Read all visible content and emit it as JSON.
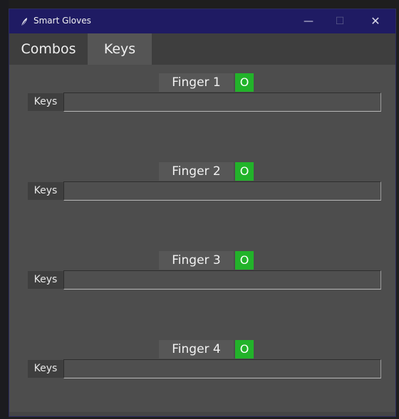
{
  "window": {
    "title": "Smart Gloves",
    "minimize_glyph": "—",
    "maximize_glyph": "☐",
    "close_glyph": "✕"
  },
  "tabs": [
    {
      "label": "Combos",
      "selected": false
    },
    {
      "label": "Keys",
      "selected": true
    }
  ],
  "fingers": [
    {
      "label": "Finger 1",
      "status": "O",
      "keys_label": "Keys",
      "keys_value": ""
    },
    {
      "label": "Finger 2",
      "status": "O",
      "keys_label": "Keys",
      "keys_value": ""
    },
    {
      "label": "Finger 3",
      "status": "O",
      "keys_label": "Keys",
      "keys_value": ""
    },
    {
      "label": "Finger 4",
      "status": "O",
      "keys_label": "Keys",
      "keys_value": ""
    }
  ],
  "colors": {
    "titlebar": "#1f1b63",
    "status_on": "#22b32a",
    "background": "#4d4d4d"
  },
  "icons": {
    "app": "feather-icon",
    "minimize": "minimize-icon",
    "maximize": "maximize-icon",
    "close": "close-icon"
  }
}
